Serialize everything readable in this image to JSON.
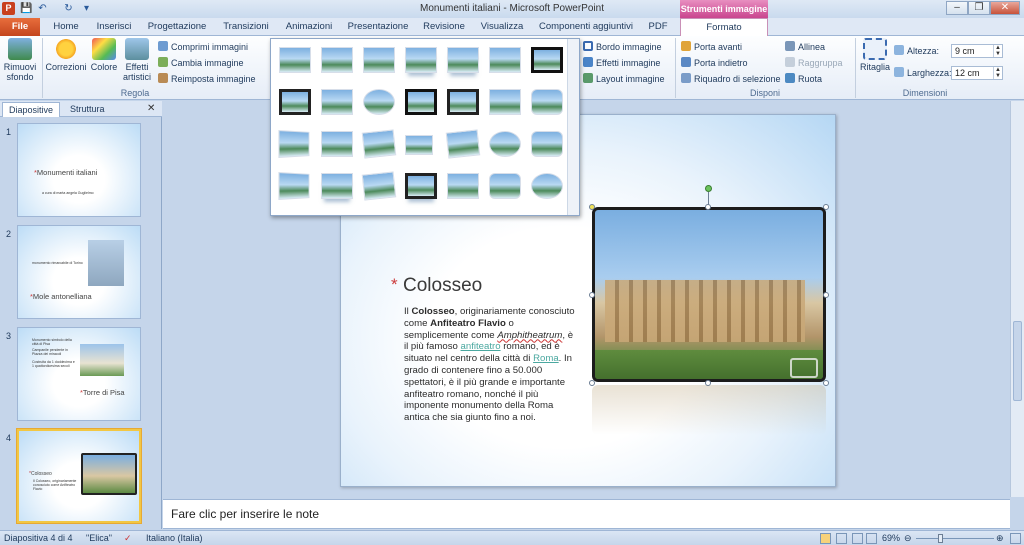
{
  "window": {
    "title": "Monumenti italiani - Microsoft PowerPoint",
    "context_tools": "Strumenti immagine",
    "buttons": [
      "–",
      "❐",
      "✕"
    ]
  },
  "quick_access": [
    "P",
    "💾",
    "↶",
    "↻",
    "▾"
  ],
  "tabs": [
    "File",
    "Home",
    "Inserisci",
    "Progettazione",
    "Transizioni",
    "Animazioni",
    "Presentazione",
    "Revisione",
    "Visualizza",
    "Componenti aggiuntivi",
    "PDF",
    "Formato"
  ],
  "ribbon": {
    "rimuovi_sfondo": "Rimuovi sfondo",
    "correzioni": "Correzioni",
    "colore": "Colore",
    "effetti_artistici": "Effetti artistici",
    "comprimi": "Comprimi immagini",
    "cambia": "Cambia immagine",
    "reimposta": "Reimposta immagine",
    "regola_label": "Regola",
    "bordo": "Bordo immagine",
    "effetti": "Effetti immagine",
    "layout": "Layout immagine",
    "porta_avanti": "Porta avanti",
    "porta_indietro": "Porta indietro",
    "riquadro": "Riquadro di selezione",
    "allinea": "Allinea",
    "raggruppa": "Raggruppa",
    "ruota": "Ruota",
    "disponi_label": "Disponi",
    "ritaglia": "Ritaglia",
    "altezza_label": "Altezza:",
    "altezza_value": "9 cm",
    "larghezza_label": "Larghezza:",
    "larghezza_value": "12 cm",
    "dimensioni_label": "Dimensioni"
  },
  "pane": {
    "tab_diapositive": "Diapositive",
    "tab_struttura": "Struttura",
    "close": "✕"
  },
  "slides": [
    {
      "num": "1",
      "title": "Monumenti italiani",
      "text": "a cura di marta angela Guglielmo"
    },
    {
      "num": "2",
      "title": "Mole antonelliana",
      "text": "monumento rimarcabile di Torino"
    },
    {
      "num": "3",
      "title": "Torre di Pisa",
      "lines": [
        "Monumento simbolo della città di Pisa",
        "Campanile pendente in Piazza dei miracoli",
        "Costruita da 1 doddecima e 1 quattordicesima secoli"
      ]
    },
    {
      "num": "4",
      "title": "Colosseo",
      "text": "Il Colosseo, originariamente conosciuto come Anfiteatro Flavio"
    }
  ],
  "slide": {
    "title": "Colosseo",
    "star": "*",
    "body": {
      "p1": "Il ",
      "b1": "Colosseo",
      "p2": ", originariamente conosciuto come ",
      "b2": "Anfiteatro Flavio",
      "p3": " o semplicemente come ",
      "i1": "Amphitheatrum",
      "p4": ", è il più famoso ",
      "l1": "anfiteatro",
      "p5": " romano, ed è situato nel centro della  città di ",
      "l2": "Roma",
      "p6": ". In grado di contenere fino a 50.000 spettatori, è il più grande e importante anfiteatro romano, nonché il più imponente monumento della Roma antica che  sia giunto fino a noi."
    }
  },
  "notes": "Fare clic per inserire le note",
  "status": {
    "slide": "Diapositiva 4 di 4",
    "theme": "\"Elica\"",
    "language": "Italiano (Italia)",
    "zoom": "69%",
    "minus": "⊖",
    "plus": "⊕"
  }
}
